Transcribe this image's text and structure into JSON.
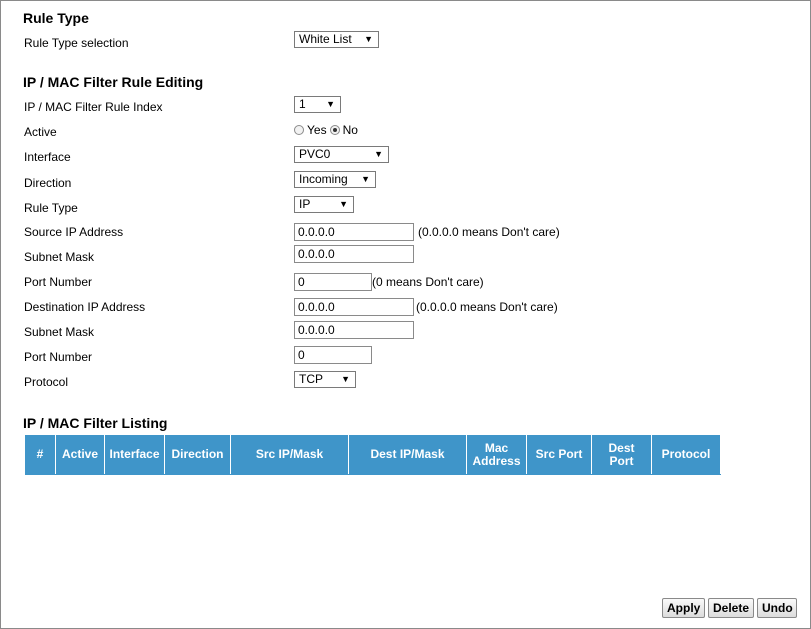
{
  "rule_type_section": {
    "title": "Rule Type",
    "selection_label": "Rule Type selection",
    "selection_value": "White List"
  },
  "editing_section": {
    "title": "IP / MAC Filter Rule Editing",
    "rule_index": {
      "label": "IP / MAC Filter Rule Index",
      "value": "1"
    },
    "active": {
      "label": "Active",
      "yes_label": "Yes",
      "no_label": "No",
      "selected": "No"
    },
    "interface": {
      "label": "Interface",
      "value": "PVC0"
    },
    "direction": {
      "label": "Direction",
      "value": "Incoming"
    },
    "rule_type": {
      "label": "Rule Type",
      "value": "IP"
    },
    "source_ip": {
      "label": "Source IP Address",
      "value": "0.0.0.0",
      "hint": "(0.0.0.0 means Don't care)"
    },
    "source_mask": {
      "label": "Subnet Mask",
      "value": "0.0.0.0"
    },
    "source_port": {
      "label": "Port Number",
      "value": "0",
      "hint": "(0 means Don't care)"
    },
    "dest_ip": {
      "label": "Destination IP Address",
      "value": "0.0.0.0",
      "hint": "(0.0.0.0 means Don't care)"
    },
    "dest_mask": {
      "label": "Subnet Mask",
      "value": "0.0.0.0"
    },
    "dest_port": {
      "label": "Port Number",
      "value": "0"
    },
    "protocol": {
      "label": "Protocol",
      "value": "TCP"
    }
  },
  "listing_section": {
    "title": "IP / MAC Filter Listing",
    "columns": [
      {
        "line1": "#",
        "line2": ""
      },
      {
        "line1": "Active",
        "line2": ""
      },
      {
        "line1": "Interface",
        "line2": ""
      },
      {
        "line1": "Direction",
        "line2": ""
      },
      {
        "line1": "Src IP/Mask",
        "line2": ""
      },
      {
        "line1": "Dest IP/Mask",
        "line2": ""
      },
      {
        "line1": "Mac",
        "line2": "Address"
      },
      {
        "line1": "Src Port",
        "line2": ""
      },
      {
        "line1": "Dest",
        "line2": "Port"
      },
      {
        "line1": "Protocol",
        "line2": ""
      }
    ]
  },
  "buttons": {
    "apply": "Apply",
    "delete": "Delete",
    "undo": "Undo"
  },
  "colors": {
    "table_header_bg": "#3f95c9",
    "table_header_text": "#ffffff"
  }
}
